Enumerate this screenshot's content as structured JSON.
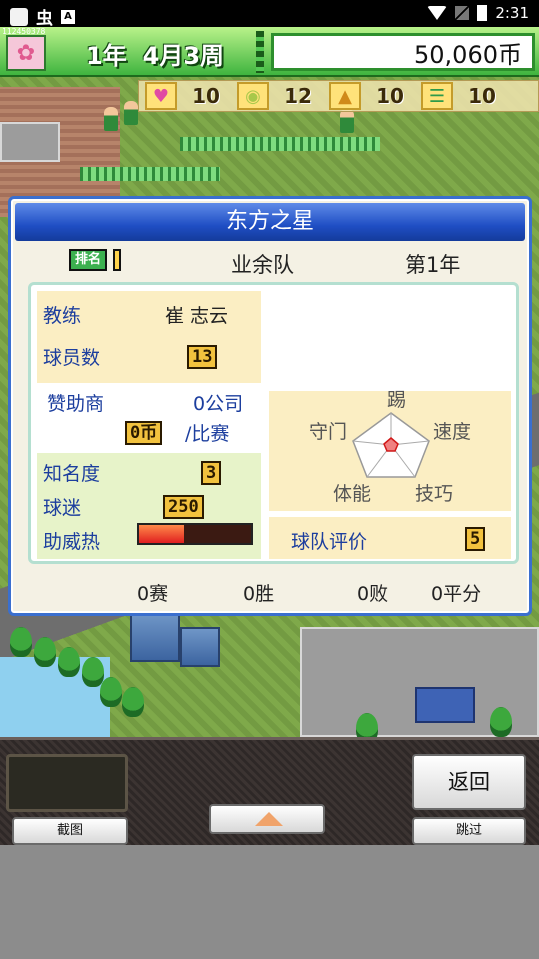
{
  "statusbar": {
    "bug_glyph": "虫",
    "a_glyph": "A",
    "time": "2:31"
  },
  "hud": {
    "id_text": "112450378",
    "year": "1年",
    "month_week": "4月3周",
    "money": "50,060币"
  },
  "resources": [
    {
      "icon": "heart-icon",
      "glyph": "♥",
      "value": "10"
    },
    {
      "icon": "bulb-icon",
      "glyph": "◉",
      "value": "12"
    },
    {
      "icon": "pile-icon",
      "glyph": "▲",
      "value": "10"
    },
    {
      "icon": "ladder-icon",
      "glyph": "☰",
      "value": "10"
    }
  ],
  "panel": {
    "title": "东方之星",
    "rank_badge": "排名",
    "team_level": "业余队",
    "year": "第1年",
    "coach_label": "教练",
    "coach_value": "崔 志云",
    "players_label": "球员数",
    "players_value": "13",
    "sponsor_label": "赞助商",
    "sponsor_value": "0公司",
    "sponsor_fee_value": "0币",
    "sponsor_fee_unit": "/比赛",
    "fame_label": "知名度",
    "fame_value": "3",
    "fans_label": "球迷",
    "fans_value": "250",
    "cheer_label": "助威热",
    "cheer_level": 0.4,
    "radar": {
      "top": "踢",
      "left": "守门",
      "right": "速度",
      "bottom_left": "体能",
      "bottom_right": "技巧"
    },
    "rating_label": "球队评价",
    "rating_value": "5",
    "record": {
      "games": "0赛",
      "wins": "0胜",
      "losses": "0败",
      "draws": "0平分"
    }
  },
  "controls": {
    "screenshot_label": "截图",
    "back_label": "返回",
    "skip_label": "跳过"
  },
  "colors": {
    "title_blue": "#1f4ec4",
    "hud_green": "#3fb43f",
    "label_blue": "#1c3e9e"
  }
}
